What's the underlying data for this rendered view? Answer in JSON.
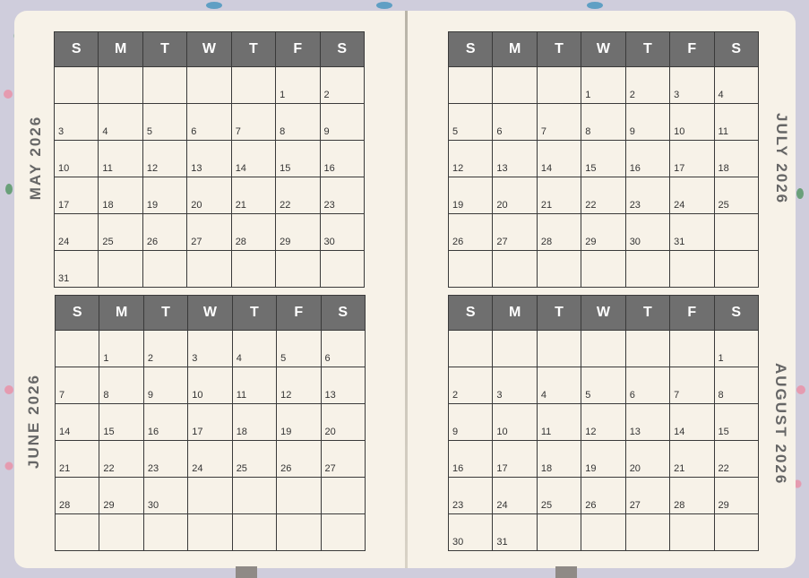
{
  "weekdays": [
    "S",
    "M",
    "T",
    "W",
    "T",
    "F",
    "S"
  ],
  "months": [
    {
      "id": "may",
      "label": "MAY 2026",
      "weeks": [
        [
          "",
          "",
          "",
          "",
          "",
          "1",
          "2"
        ],
        [
          "3",
          "4",
          "5",
          "6",
          "7",
          "8",
          "9"
        ],
        [
          "10",
          "11",
          "12",
          "13",
          "14",
          "15",
          "16"
        ],
        [
          "17",
          "18",
          "19",
          "20",
          "21",
          "22",
          "23"
        ],
        [
          "24",
          "25",
          "26",
          "27",
          "28",
          "29",
          "30"
        ],
        [
          "31",
          "",
          "",
          "",
          "",
          "",
          ""
        ]
      ]
    },
    {
      "id": "june",
      "label": "JUNE 2026",
      "weeks": [
        [
          "",
          "1",
          "2",
          "3",
          "4",
          "5",
          "6"
        ],
        [
          "7",
          "8",
          "9",
          "10",
          "11",
          "12",
          "13"
        ],
        [
          "14",
          "15",
          "16",
          "17",
          "18",
          "19",
          "20"
        ],
        [
          "21",
          "22",
          "23",
          "24",
          "25",
          "26",
          "27"
        ],
        [
          "28",
          "29",
          "30",
          "",
          "",
          "",
          ""
        ],
        [
          "",
          "",
          "",
          "",
          "",
          "",
          ""
        ]
      ]
    },
    {
      "id": "july",
      "label": "JULY 2026",
      "weeks": [
        [
          "",
          "",
          "",
          "1",
          "2",
          "3",
          "4"
        ],
        [
          "5",
          "6",
          "7",
          "8",
          "9",
          "10",
          "11"
        ],
        [
          "12",
          "13",
          "14",
          "15",
          "16",
          "17",
          "18"
        ],
        [
          "19",
          "20",
          "21",
          "22",
          "23",
          "24",
          "25"
        ],
        [
          "26",
          "27",
          "28",
          "29",
          "30",
          "31",
          ""
        ],
        [
          "",
          "",
          "",
          "",
          "",
          "",
          ""
        ]
      ]
    },
    {
      "id": "august",
      "label": "AUGUST 2026",
      "weeks": [
        [
          "",
          "",
          "",
          "",
          "",
          "",
          "1"
        ],
        [
          "2",
          "3",
          "4",
          "5",
          "6",
          "7",
          "8"
        ],
        [
          "9",
          "10",
          "11",
          "12",
          "13",
          "14",
          "15"
        ],
        [
          "16",
          "17",
          "18",
          "19",
          "20",
          "21",
          "22"
        ],
        [
          "23",
          "24",
          "25",
          "26",
          "27",
          "28",
          "29"
        ],
        [
          "30",
          "31",
          "",
          "",
          "",
          "",
          ""
        ]
      ]
    }
  ],
  "colors": {
    "header": "#6f6f6f",
    "paper": "#f7f2e8",
    "label": "#666666"
  }
}
